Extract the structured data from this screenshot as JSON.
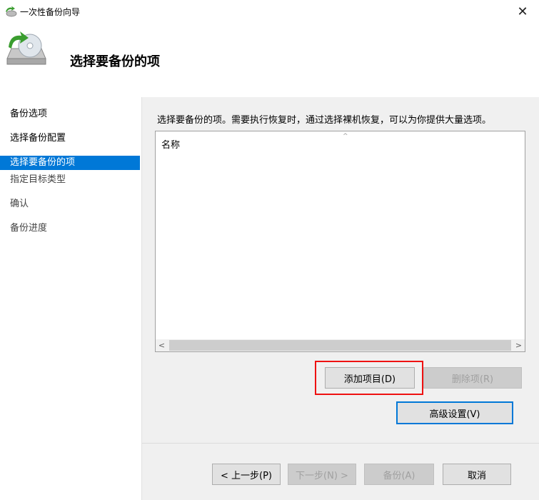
{
  "window": {
    "title": "一次性备份向导",
    "close_glyph": "✕"
  },
  "header": {
    "title": "选择要备份的项"
  },
  "sidebar": {
    "items": [
      {
        "label": "备份选项",
        "state": "normal"
      },
      {
        "label": "选择备份配置",
        "state": "normal"
      },
      {
        "label": "选择要备份的项",
        "state": "active"
      },
      {
        "label": "指定目标类型",
        "state": "normal"
      },
      {
        "label": "确认",
        "state": "normal"
      },
      {
        "label": "备份进度",
        "state": "normal"
      }
    ]
  },
  "main": {
    "instruction": "选择要备份的项。需要执行恢复时，通过选择裸机恢复，可以为你提供大量选项。",
    "list": {
      "column_name": "名称",
      "sort_glyph": "^",
      "scroll_left": "<",
      "scroll_right": ">"
    },
    "buttons": {
      "add_items": "添加项目(D)",
      "remove_items": "删除项(R)",
      "advanced": "高级设置(V)"
    }
  },
  "footer": {
    "back": "< 上一步(P)",
    "next": "下一步(N) >",
    "backup": "备份(A)",
    "cancel": "取消"
  },
  "colors": {
    "accent": "#0078d7",
    "highlight": "#e11111"
  }
}
